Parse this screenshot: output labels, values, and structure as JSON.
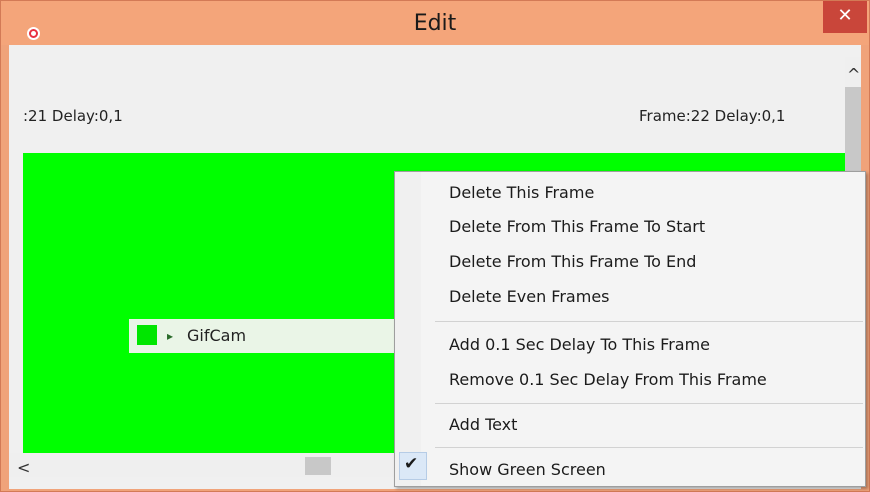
{
  "window": {
    "title": "Edit",
    "close_glyph": "✕"
  },
  "frames": {
    "left_label": ":21 Delay:0,1",
    "right_label": "Frame:22 Delay:0,1"
  },
  "frame_item": {
    "label": "GifCam",
    "arrow": "▸"
  },
  "scroll": {
    "up": "^",
    "left": "<"
  },
  "context_menu": {
    "items": [
      {
        "label": "Delete This Frame"
      },
      {
        "label": "Delete From This Frame To Start"
      },
      {
        "label": "Delete From This Frame To End"
      },
      {
        "label": "Delete Even Frames"
      },
      {
        "label": "Add 0.1 Sec Delay To This Frame"
      },
      {
        "label": "Remove 0.1 Sec Delay From This Frame"
      },
      {
        "label": "Add Text"
      },
      {
        "label": "Show Green Screen",
        "checked": true
      }
    ],
    "check_glyph": "✔"
  },
  "colors": {
    "titlebar": "#f4a57a",
    "close": "#c9463a",
    "green_screen": "#00ff00",
    "menu_bg": "#f4f4f4",
    "check_bg": "#dbe8f7"
  },
  "icons": {
    "app": "gifcam-app-icon",
    "close": "close-icon",
    "check": "check-icon",
    "scroll_up": "chevron-up-icon",
    "scroll_left": "chevron-left-icon"
  }
}
